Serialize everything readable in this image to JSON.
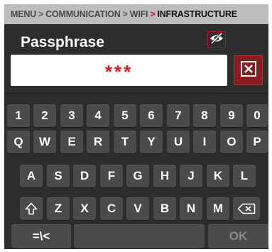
{
  "breadcrumb": {
    "items": [
      "MENU",
      "COMMUNICATION",
      "WIFI"
    ],
    "current": "INFRASTRUCTURE",
    "separator": ">"
  },
  "field": {
    "title": "Passphrase",
    "value": "***"
  },
  "icons": {
    "visibility": "eye-off-icon",
    "clear": "clear-x-icon",
    "shift": "shift-arrow-icon",
    "backspace": "backspace-icon"
  },
  "keyboard": {
    "row1": [
      "1",
      "2",
      "3",
      "4",
      "5",
      "6",
      "7",
      "8",
      "9",
      "0"
    ],
    "row2": [
      "Q",
      "W",
      "E",
      "R",
      "T",
      "Y",
      "U",
      "I",
      "O",
      "P"
    ],
    "row3": [
      "A",
      "S",
      "D",
      "F",
      "G",
      "H",
      "J",
      "K",
      "L"
    ],
    "row4": [
      "Z",
      "X",
      "C",
      "V",
      "B",
      "N",
      "M"
    ],
    "symbols_label": "=\\<",
    "space_label": "",
    "ok_label": "OK"
  },
  "colors": {
    "accent_red": "#c8102e",
    "background": "#2d2d2d",
    "key": "#4b4b4b",
    "breadcrumb_bar": "#bdbdbd"
  }
}
